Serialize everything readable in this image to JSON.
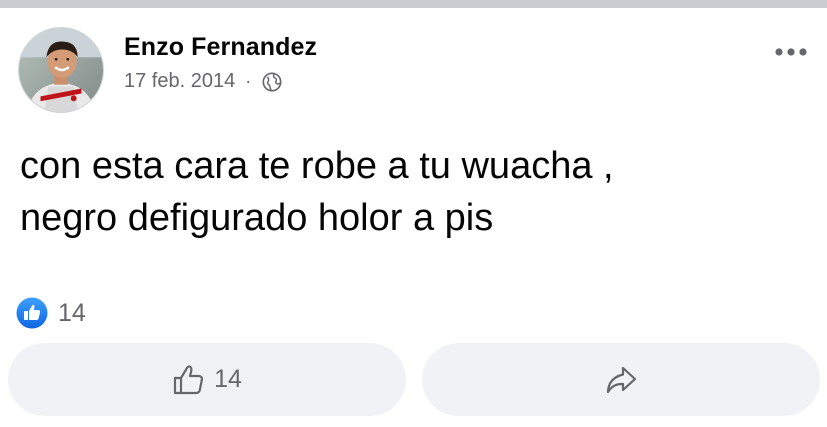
{
  "post": {
    "author": "Enzo Fernandez",
    "date": "17 feb. 2014",
    "separator": "·",
    "audience_icon": "globe-icon",
    "text_lines": [
      "con esta cara te robe a tu wuacha ,",
      "negro defigurado holor a pis"
    ]
  },
  "reactions": {
    "icon": "like-reaction-icon",
    "count": "14"
  },
  "actions": {
    "like_count": "14",
    "like_icon": "thumbs-up-outline-icon",
    "share_icon": "share-arrow-icon"
  },
  "colors": {
    "text": "#050505",
    "secondary": "#65676b",
    "button_bg": "#f0f2f5",
    "like_blue": "#1877f2"
  }
}
